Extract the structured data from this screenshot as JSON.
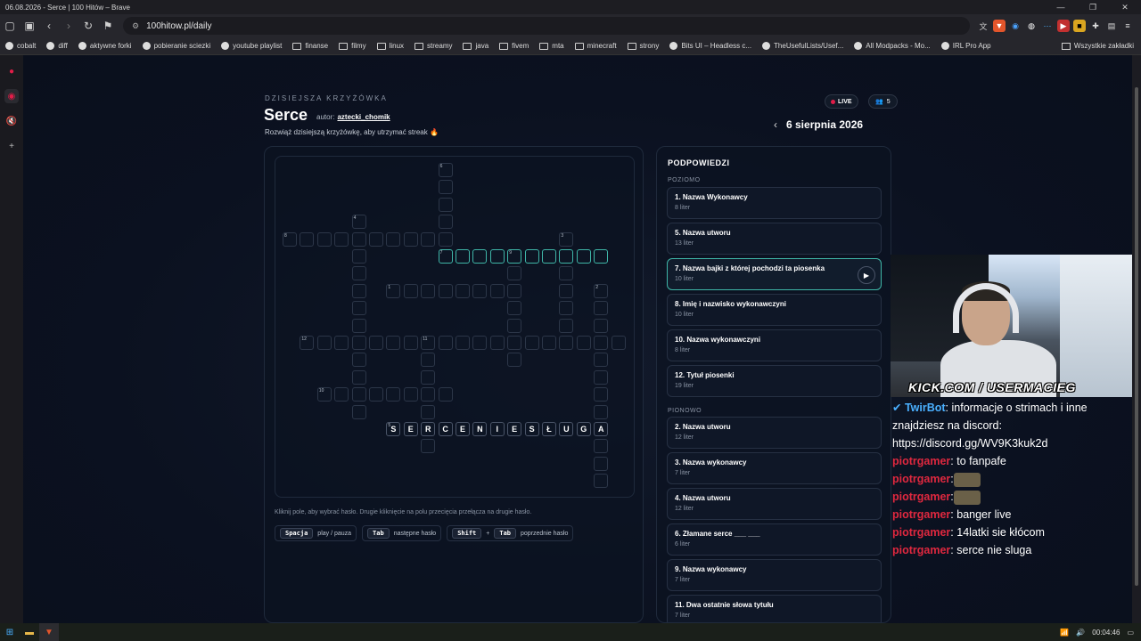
{
  "window": {
    "title": "06.08.2026 - Serce | 100 Hitów – Brave"
  },
  "browser": {
    "url": "100hitow.pl/daily"
  },
  "bookmarks": [
    "cobalt",
    "diff",
    "aktywne forki",
    "pobieranie sciezki",
    "youtube playlist",
    "finanse",
    "filmy",
    "linux",
    "streamy",
    "java",
    "fivem",
    "mta",
    "minecraft",
    "strony",
    "Bits UI – Headless c...",
    "TheUsefulLists/Usef...",
    "All Modpacks - Mo...",
    "IRL Pro App"
  ],
  "bookmarks_right": "Wszystkie zakładki",
  "page": {
    "kicker": "DZISIEJSZA KRZYŻÓWKA",
    "title": "Serce",
    "author_label": "autor:",
    "author_name": "aztecki_chomik",
    "subtitle": "Rozwiąż dzisiejszą krzyżówkę, aby utrzymać streak 🔥",
    "live": "LIVE",
    "viewers": "5",
    "date": "6 sierpnia 2026",
    "hint": "Kliknij pole, aby wybrać hasło. Drugie kliknięcie na polu przecięcia przełącza na drugie hasło.",
    "keys": [
      {
        "keys": [
          "Spacja"
        ],
        "label": "play / pauza"
      },
      {
        "keys": [
          "Tab"
        ],
        "label": "następne hasło"
      },
      {
        "keys": [
          "Shift",
          "Tab"
        ],
        "label": "poprzednie hasło"
      }
    ]
  },
  "grid": {
    "filled_word": "SERCENIESŁUGA"
  },
  "clues": {
    "heading": "PODPOWIEDZI",
    "across_label": "POZIOMO",
    "down_label": "PIONOWO",
    "across": [
      {
        "title": "1. Nazwa Wykonawcy",
        "len": "8 liter"
      },
      {
        "title": "5. Nazwa utworu",
        "len": "13 liter"
      },
      {
        "title": "7. Nazwa bajki z której pochodzi ta piosenka",
        "len": "10 liter"
      },
      {
        "title": "8. Imię i nazwisko wykonawczyni",
        "len": "10 liter"
      },
      {
        "title": "10. Nazwa wykonawczyni",
        "len": "8 liter"
      },
      {
        "title": "12. Tytuł piosenki",
        "len": "19 liter"
      }
    ],
    "down": [
      {
        "title": "2. Nazwa utworu",
        "len": "12 liter"
      },
      {
        "title": "3. Nazwa wykonawcy",
        "len": "7 liter"
      },
      {
        "title": "4. Nazwa utworu",
        "len": "12 liter"
      },
      {
        "title": "6. Złamane serce ___ ___",
        "len": "6 liter"
      },
      {
        "title": "9. Nazwa wykonawcy",
        "len": "7 liter"
      },
      {
        "title": "11. Dwa ostatnie słowa tytułu",
        "len": "7 liter"
      }
    ]
  },
  "stream": {
    "tag": "KICK.COM / USERMACIEG",
    "chat": [
      {
        "user": "TwirBot",
        "bot": true,
        "msg": ": informacje o strimach i inne znajdziesz na discord: https://discord.gg/WV9K3kuk2d"
      },
      {
        "user": "piotrgamer",
        "msg": ": to fanpafe"
      },
      {
        "user": "piotrgamer",
        "msg": ":",
        "emote": true
      },
      {
        "user": "piotrgamer",
        "msg": ":",
        "emote": true
      },
      {
        "user": "piotrgamer",
        "msg": ": banger live"
      },
      {
        "user": "piotrgamer",
        "msg": ": 14latki sie kłócom"
      },
      {
        "user": "piotrgamer",
        "msg": ": serce nie sluga"
      }
    ]
  },
  "taskbar": {
    "time": "00:04:46"
  },
  "colors": {
    "accent": "#3fb6a8",
    "live": "#e11d48",
    "chat_user": "#e0283f"
  }
}
